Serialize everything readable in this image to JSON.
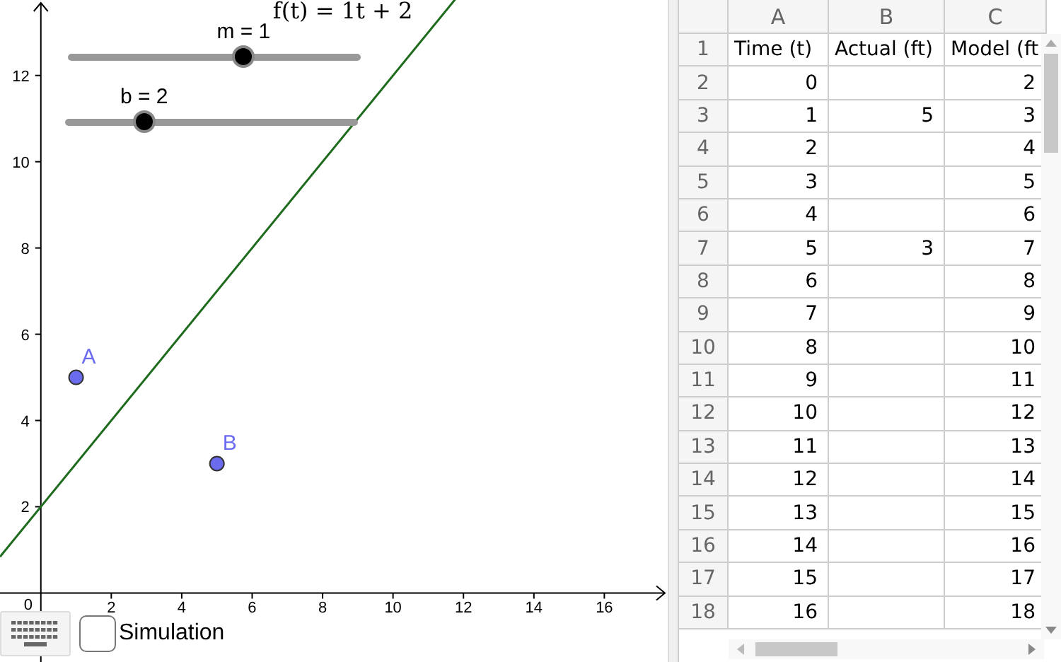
{
  "graphics": {
    "sliders": [
      {
        "label": "m = 1",
        "level": 0.6
      },
      {
        "label": "b = 2",
        "level": 0.27
      }
    ],
    "chart_data": {
      "type": "scatter",
      "x": [
        1,
        5
      ],
      "series": [
        {
          "color": "#6b6bf0",
          "values": [
            5,
            3
          ]
        }
      ],
      "xlim": [
        -1.16,
        17.8
      ],
      "ylim": [
        -1.6,
        13.75
      ],
      "xticks": [
        2,
        4,
        6,
        8,
        10,
        12,
        14,
        16
      ],
      "yticks": [
        2,
        4,
        6,
        8,
        10,
        12
      ],
      "annotations": [
        {
          "text": "A",
          "x": 1,
          "y": 5
        },
        {
          "text": "B",
          "x": 5,
          "y": 3
        }
      ]
    },
    "origin_label": "0",
    "function_label": "f(t) = 1t + 2",
    "checkbox": {
      "label": "Simulation",
      "checked": false
    }
  },
  "spreadsheet": {
    "columns": [
      "A",
      "B",
      "C"
    ],
    "rows": [
      {
        "row": "1",
        "a": "Time (t)",
        "b": "Actual (ft)",
        "c": "Model (ft"
      },
      {
        "row": "2",
        "a": "0",
        "c": "2"
      },
      {
        "row": "3",
        "a": "1",
        "b": "5",
        "c": "3"
      },
      {
        "row": "4",
        "a": "2",
        "c": "4"
      },
      {
        "row": "5",
        "a": "3",
        "c": "5"
      },
      {
        "row": "6",
        "a": "4",
        "c": "6"
      },
      {
        "row": "7",
        "a": "5",
        "b": "3",
        "c": "7"
      },
      {
        "row": "8",
        "a": "6",
        "c": "8"
      },
      {
        "row": "9",
        "a": "7",
        "c": "9"
      },
      {
        "row": "10",
        "a": "8",
        "c": "10"
      },
      {
        "row": "11",
        "a": "9",
        "c": "11"
      },
      {
        "row": "12",
        "a": "10",
        "c": "12"
      },
      {
        "row": "13",
        "a": "11",
        "c": "13"
      },
      {
        "row": "14",
        "a": "12",
        "c": "14"
      },
      {
        "row": "15",
        "a": "13",
        "c": "15"
      },
      {
        "row": "16",
        "a": "14",
        "c": "16"
      },
      {
        "row": "17",
        "a": "15",
        "c": "17"
      },
      {
        "row": "18",
        "a": "16",
        "c": "18"
      }
    ]
  }
}
